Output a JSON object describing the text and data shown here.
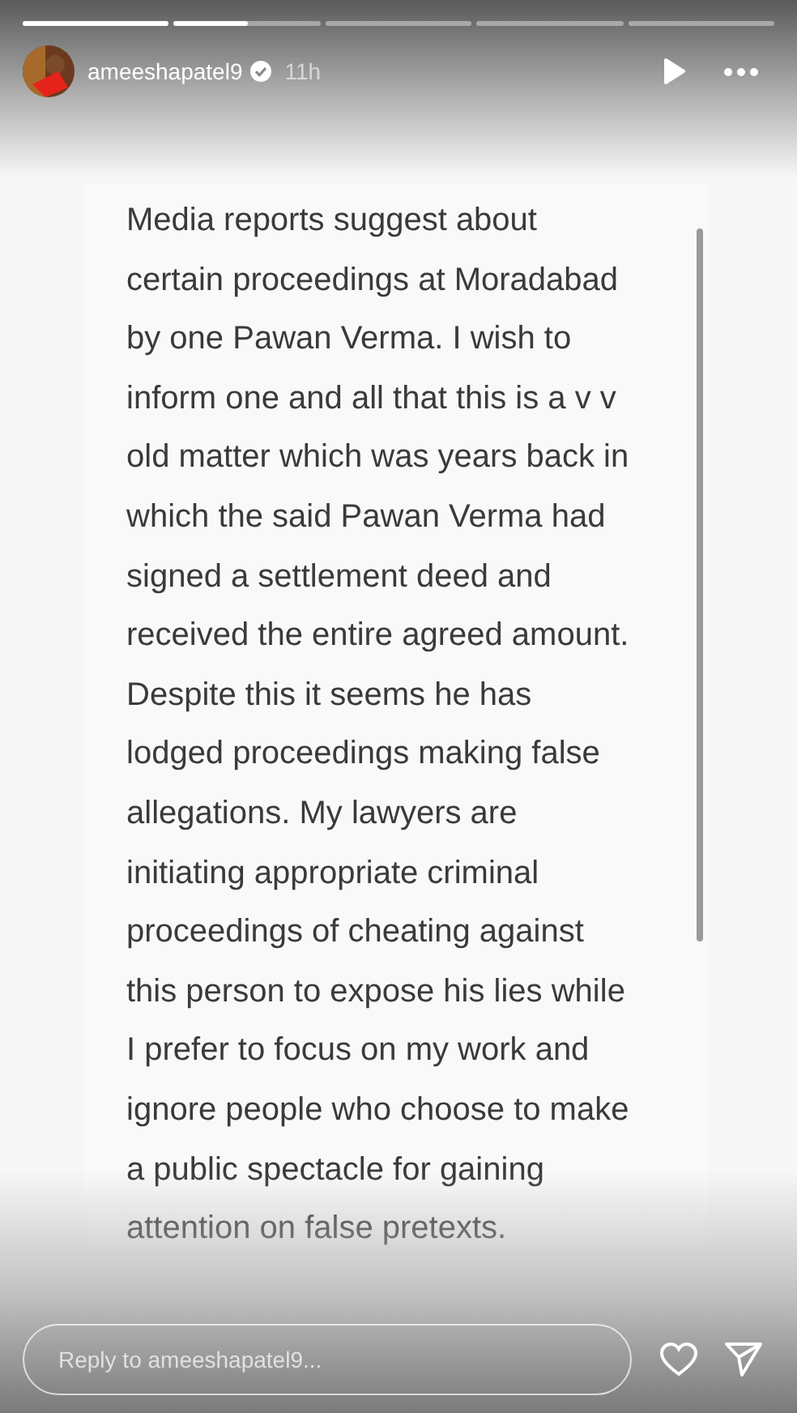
{
  "progress": [
    {
      "level": 1
    },
    {
      "level": 0.5
    },
    {
      "level": 0
    },
    {
      "level": 0
    },
    {
      "level": 0
    }
  ],
  "header": {
    "username": "ameeshapatel9",
    "verified": true,
    "time": "11h"
  },
  "note_lines": [
    "Media reports suggest about",
    "certain proceedings at Moradabad",
    "by one Pawan Verma. I wish to",
    "inform one and all that this is a v v",
    "old matter which was years back in",
    "which the said Pawan Verma had",
    "signed a settlement deed and",
    "received the entire agreed amount.",
    "Despite this it seems he has",
    "lodged proceedings making false",
    "allegations. My lawyers are",
    "initiating appropriate criminal",
    "proceedings of cheating against",
    "this person to expose his lies while",
    "I prefer to focus on my work and",
    "ignore people who choose to make",
    "a public spectacle for gaining",
    "attention on false pretexts."
  ],
  "reply": {
    "placeholder": "Reply to ameeshapatel9..."
  }
}
